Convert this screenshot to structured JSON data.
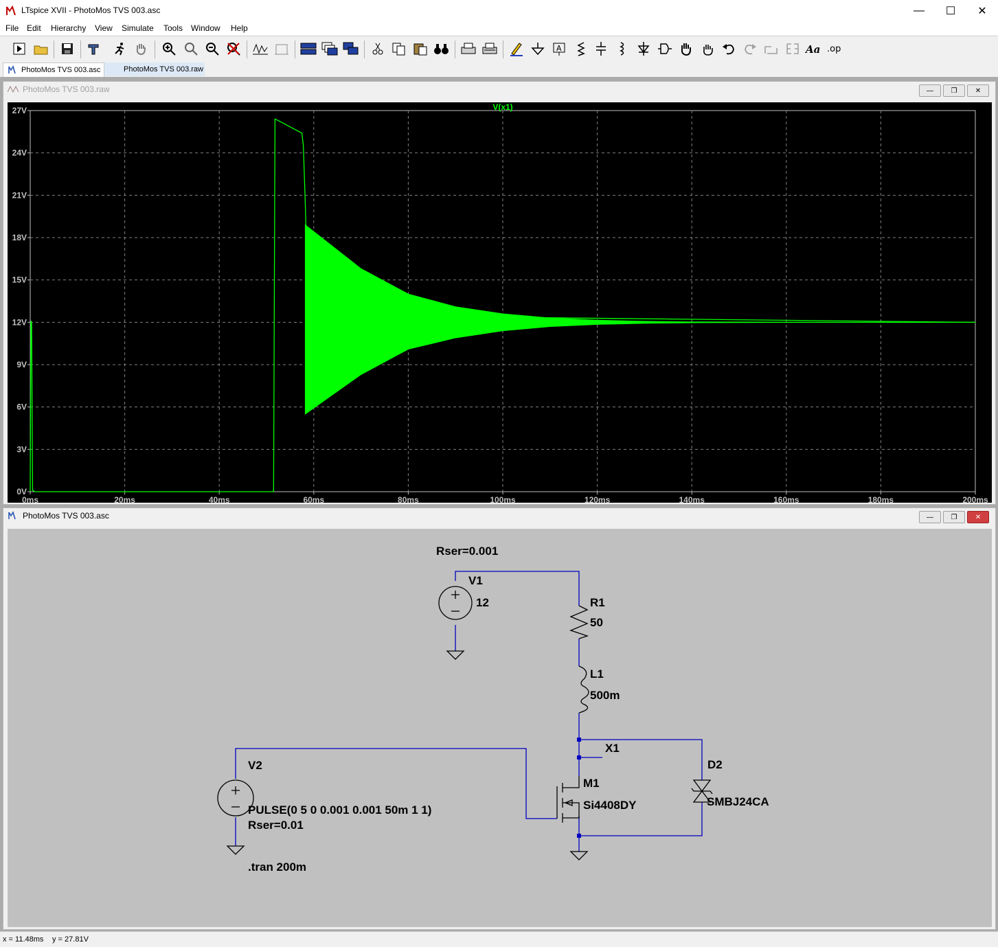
{
  "window": {
    "title": "LTspice XVII - PhotoMos TVS 003.asc"
  },
  "menu": [
    "File",
    "Edit",
    "Hierarchy",
    "View",
    "Simulate",
    "Tools",
    "Window",
    "Help"
  ],
  "tabs": [
    {
      "label": "PhotoMos TVS 003.asc",
      "active": true
    },
    {
      "label": "PhotoMos TVS 003.raw",
      "active": false
    }
  ],
  "waveform_window": {
    "title": "PhotoMos TVS 003.raw"
  },
  "schematic_window": {
    "title": "PhotoMos TVS 003.asc"
  },
  "chart_data": {
    "type": "line",
    "title": "V(x1)",
    "xlabel": "",
    "ylabel": "",
    "x_ticks": [
      "0ms",
      "20ms",
      "40ms",
      "60ms",
      "80ms",
      "100ms",
      "120ms",
      "140ms",
      "160ms",
      "180ms",
      "200ms"
    ],
    "y_ticks": [
      "0V",
      "3V",
      "6V",
      "9V",
      "12V",
      "15V",
      "18V",
      "21V",
      "24V",
      "27V"
    ],
    "xlim": [
      0,
      200
    ],
    "ylim": [
      0,
      27
    ],
    "grid": true,
    "series": [
      {
        "name": "V(x1)",
        "color": "#00ff00",
        "points": [
          [
            0,
            0
          ],
          [
            0.15,
            12.1
          ],
          [
            0.3,
            12.0
          ],
          [
            0.5,
            0.1
          ],
          [
            1,
            0
          ],
          [
            51.5,
            0
          ],
          [
            51.8,
            26.4
          ],
          [
            53,
            26.2
          ],
          [
            57.5,
            25.4
          ],
          [
            57.8,
            24.5
          ],
          [
            58.2,
            20.5
          ],
          [
            58.8,
            13
          ],
          [
            60,
            12.5
          ],
          [
            200,
            12
          ]
        ],
        "envelope": [
          [
            58.2,
            18.9,
            5.5
          ],
          [
            70,
            15.8,
            8.3
          ],
          [
            80,
            14.0,
            10.1
          ],
          [
            90,
            13.1,
            10.9
          ],
          [
            100,
            12.6,
            11.4
          ],
          [
            110,
            12.3,
            11.7
          ],
          [
            120,
            12.15,
            11.85
          ],
          [
            130,
            12.07,
            11.93
          ],
          [
            140,
            12.03,
            11.97
          ],
          [
            160,
            12.01,
            11.99
          ],
          [
            200,
            12,
            12
          ]
        ]
      }
    ]
  },
  "schematic": {
    "V1": {
      "name": "V1",
      "value": "12",
      "param": "Rser=0.001"
    },
    "R1": {
      "name": "R1",
      "value": "50"
    },
    "L1": {
      "name": "L1",
      "value": "500m"
    },
    "X1": {
      "name": "X1"
    },
    "M1": {
      "name": "M1",
      "value": "Si4408DY"
    },
    "D2": {
      "name": "D2",
      "value": "SMBJ24CA"
    },
    "V2": {
      "name": "V2",
      "value": "PULSE(0 5 0 0.001 0.001 50m 1 1)",
      "param": "Rser=0.01"
    },
    "directive": ".tran 200m",
    "wire_color": "#0000c0",
    "part_color": "#0000c0"
  },
  "status": {
    "x": "x = 11.48ms",
    "y": "y = 27.81V"
  }
}
